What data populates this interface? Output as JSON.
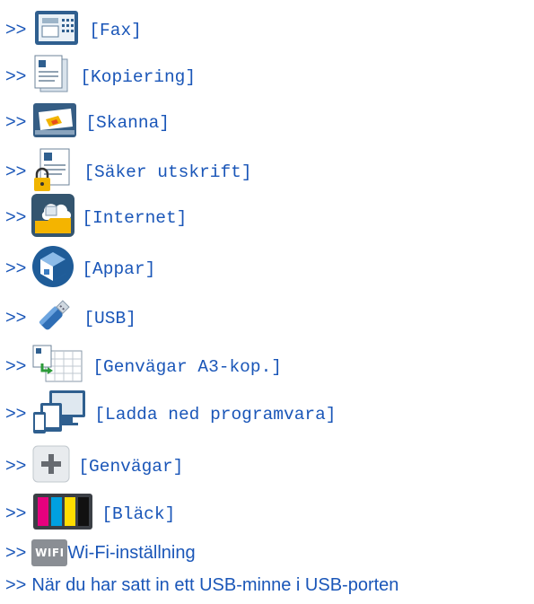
{
  "arrow": ">>",
  "items": [
    {
      "label": "[Fax]",
      "icon": "fax-icon"
    },
    {
      "label": "[Kopiering]",
      "icon": "copy-icon"
    },
    {
      "label": "[Skanna]",
      "icon": "scan-icon"
    },
    {
      "label": "[Säker utskrift]",
      "icon": "secure-print-icon"
    },
    {
      "label": "[Internet]",
      "icon": "internet-icon"
    },
    {
      "label": "[Appar]",
      "icon": "apps-icon"
    },
    {
      "label": "[USB]",
      "icon": "usb-icon"
    },
    {
      "label": "[Genvägar A3-kop.]",
      "icon": "a3-copy-shortcut-icon"
    },
    {
      "label": "[Ladda ned programvara]",
      "icon": "download-software-icon"
    },
    {
      "label": "[Genvägar]",
      "icon": "shortcuts-icon"
    },
    {
      "label": "[Bläck]",
      "icon": "ink-icon"
    }
  ],
  "wifi": {
    "badge": "WiFi",
    "label": "Wi-Fi-inställning",
    "icon": "wifi-icon"
  },
  "usb_note": {
    "label": "När du har satt in ett USB-minne i USB-porten"
  },
  "colors": {
    "link": "#1a56b8",
    "ink_cyan": "#00a0e0",
    "ink_magenta": "#e6007e",
    "ink_yellow": "#ffdd00",
    "ink_black": "#111111"
  }
}
